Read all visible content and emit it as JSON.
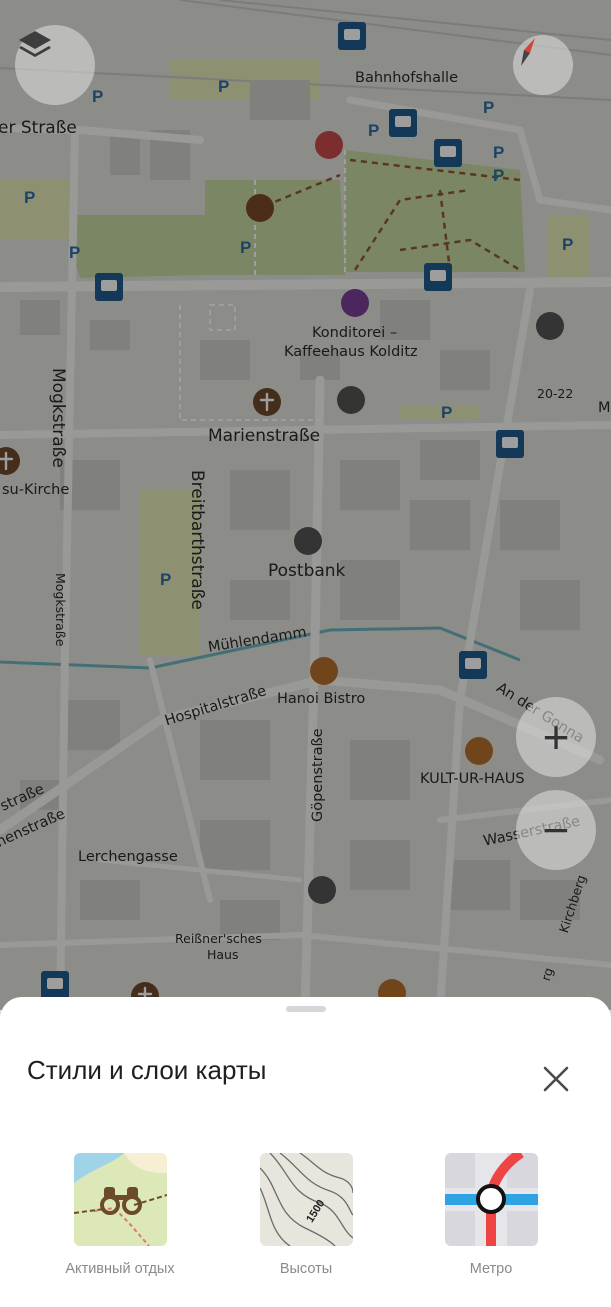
{
  "map": {
    "streets": [
      "er Straße",
      "Mogkstraße",
      "Mogkstraße",
      "Marienstraße",
      "Breitbarthstraße",
      "Mühlendamm",
      "Hospitalstraße",
      "Göpenstraße",
      "Lerchengasse",
      "straße",
      "nenstraße",
      "Wasserstraße",
      "Kirchberg",
      "An der Gonna",
      "rg"
    ],
    "places": [
      "Bahnhofshalle",
      "Konditorei –",
      "Kaffeehaus Kolditz",
      "Postbank",
      "Hanoi Bistro",
      "KULT-UR-HAUS",
      "Reißner'sches",
      "Haus",
      "su-Kirche",
      "20-22",
      "M"
    ],
    "parking": "P",
    "icons": [
      "layers-icon",
      "compass-icon",
      "bus-stop-icon",
      "parking-icon",
      "museum-icon",
      "pharmacy-icon",
      "church-icon",
      "bank-icon",
      "restaurant-icon",
      "cafe-icon",
      "theatre-icon"
    ]
  },
  "controls": {
    "zoom_in": "+",
    "zoom_out": "−"
  },
  "sheet": {
    "title": "Стили и слои карты",
    "layers": [
      {
        "label": "Активный отдых"
      },
      {
        "label": "Высоты",
        "contour_label": "1500"
      },
      {
        "label": "Метро"
      }
    ]
  },
  "colors": {
    "overlay": "rgba(0,0,0,0.38)",
    "sheet_bg": "#ffffff",
    "bus_blue": "#1f5b8f",
    "metro_red": "#ef4444",
    "metro_blue": "#2ea3e4"
  }
}
